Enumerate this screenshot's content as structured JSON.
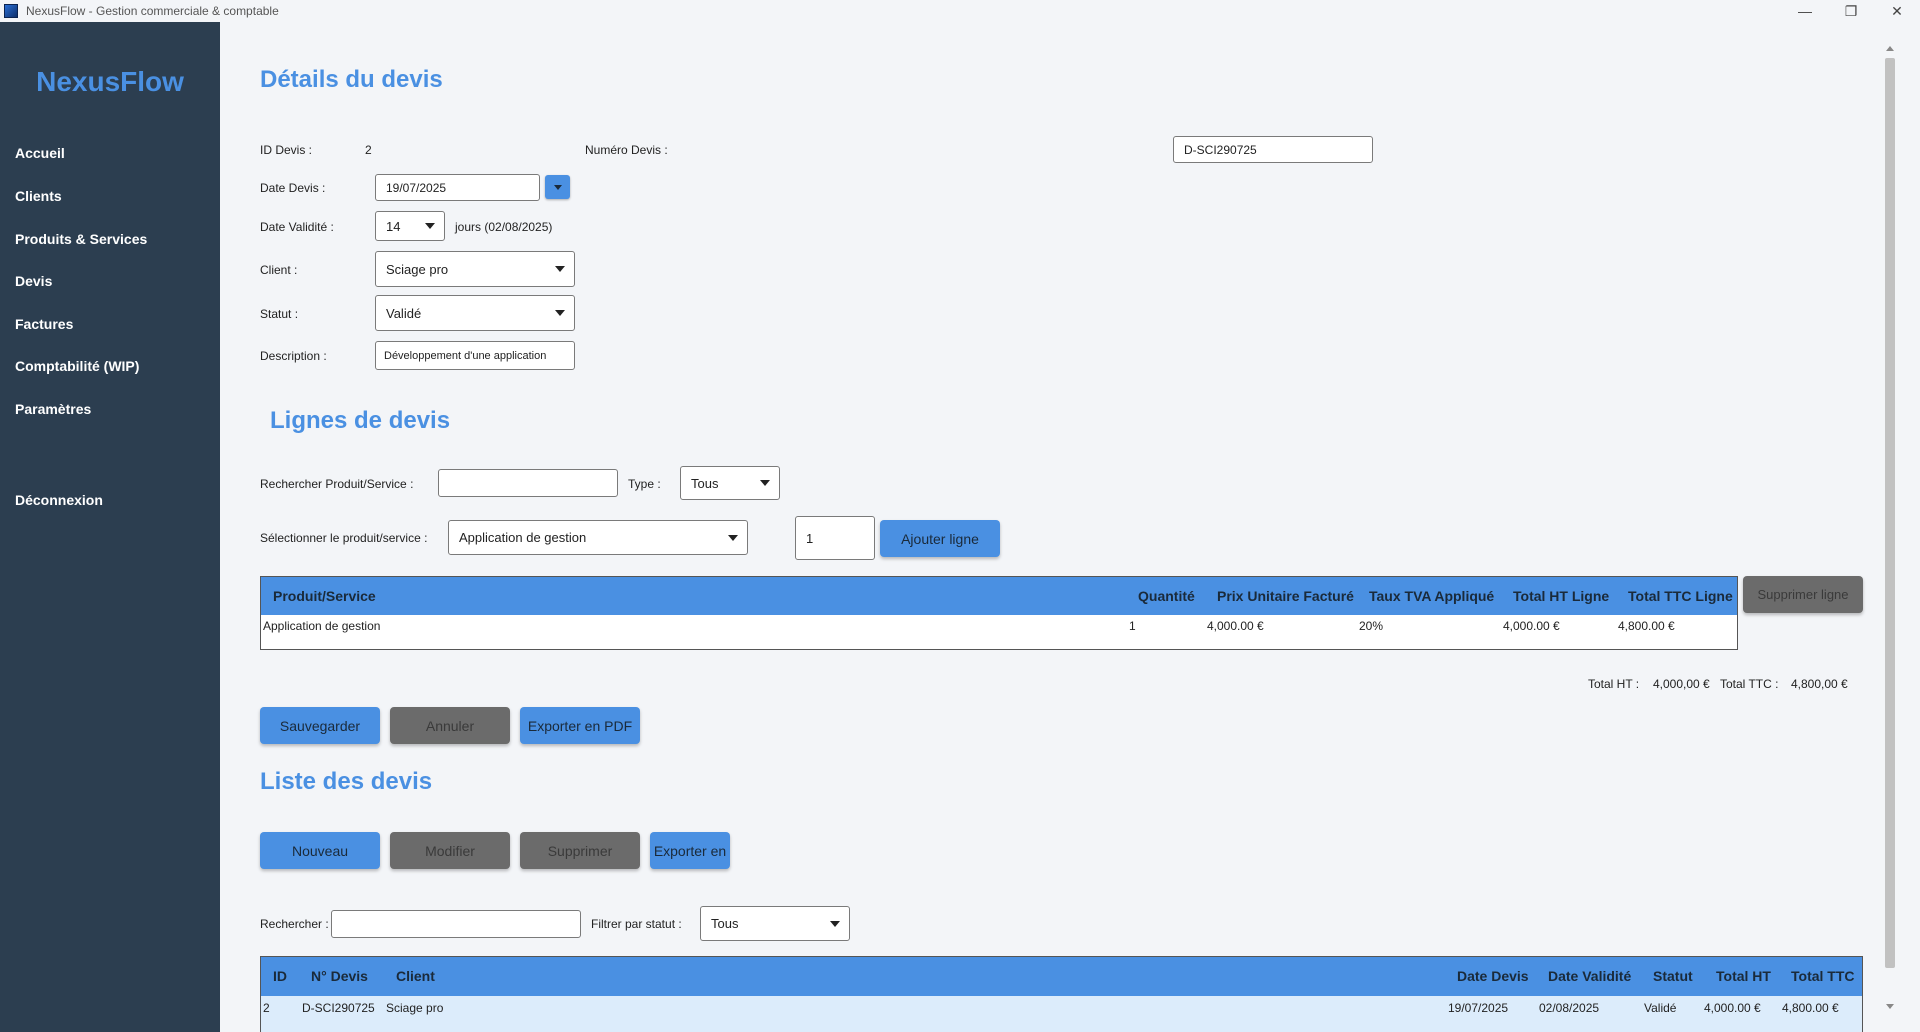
{
  "window": {
    "title": "NexusFlow - Gestion commerciale & comptable",
    "controls": [
      "minimize-icon",
      "maximize-icon",
      "close-icon"
    ]
  },
  "sidebar": {
    "brand": "NexusFlow",
    "items": [
      {
        "label": "Accueil"
      },
      {
        "label": "Clients"
      },
      {
        "label": "Produits & Services"
      },
      {
        "label": "Devis"
      },
      {
        "label": "Factures"
      },
      {
        "label": "Comptabilité (WIP)"
      },
      {
        "label": "Paramètres"
      },
      {
        "label": "Déconnexion"
      }
    ]
  },
  "details": {
    "title": "Détails du devis",
    "id_label": "ID Devis :",
    "id_value": "2",
    "numero_label": "Numéro Devis :",
    "numero_value": "D-SCI290725",
    "date_label": "Date Devis :",
    "date_value": "19/07/2025",
    "validite_label": "Date Validité :",
    "validite_value": "14",
    "validite_suffix": "jours (02/08/2025)",
    "client_label": "Client :",
    "client_value": "Sciage pro",
    "statut_label": "Statut :",
    "statut_value": "Validé",
    "description_label": "Description :",
    "description_value": "Développement d'une application"
  },
  "lignes": {
    "title": "Lignes de devis",
    "search_label": "Rechercher Produit/Service :",
    "search_value": "",
    "type_label": "Type :",
    "type_value": "Tous",
    "select_label": "Sélectionner le produit/service :",
    "select_value": "Application de gestion",
    "quantity_value": "1",
    "add_button": "Ajouter ligne",
    "delete_button": "Supprimer ligne",
    "columns": [
      "Produit/Service",
      "Quantité",
      "Prix Unitaire Facturé",
      "Taux TVA Appliqué",
      "Total HT Ligne",
      "Total TTC Ligne"
    ],
    "rows": [
      {
        "produit": "Application de gestion",
        "quantite": "1",
        "prix": "4,000.00 €",
        "tva": "20%",
        "total_ht": "4,000.00 €",
        "total_ttc": "4,800.00 €"
      }
    ],
    "total_ht_label": "Total HT :",
    "total_ht_value": "4,000,00 €",
    "total_ttc_label": "Total TTC :",
    "total_ttc_value": "4,800,00 €"
  },
  "actions": {
    "save": "Sauvegarder",
    "cancel": "Annuler",
    "export_pdf": "Exporter en PDF"
  },
  "liste": {
    "title": "Liste des devis",
    "new": "Nouveau",
    "edit": "Modifier",
    "delete": "Supprimer",
    "export": "Exporter en",
    "search_label": "Rechercher :",
    "search_value": "",
    "filter_label": "Filtrer par statut :",
    "filter_value": "Tous",
    "columns": [
      "ID",
      "N° Devis",
      "Client",
      "Date Devis",
      "Date Validité",
      "Statut",
      "Total HT",
      "Total TTC"
    ],
    "rows": [
      {
        "id": "2",
        "numero": "D-SCI290725",
        "client": "Sciage pro",
        "date": "19/07/2025",
        "validite": "02/08/2025",
        "statut": "Validé",
        "total_ht": "4,000.00 €",
        "total_ttc": "4,800.00 €"
      }
    ]
  },
  "colors": {
    "sidebar_bg": "#2c3e50",
    "accent": "#4a90e2",
    "button_disabled": "#6b6b6b",
    "page_bg": "#f3f5f8"
  }
}
